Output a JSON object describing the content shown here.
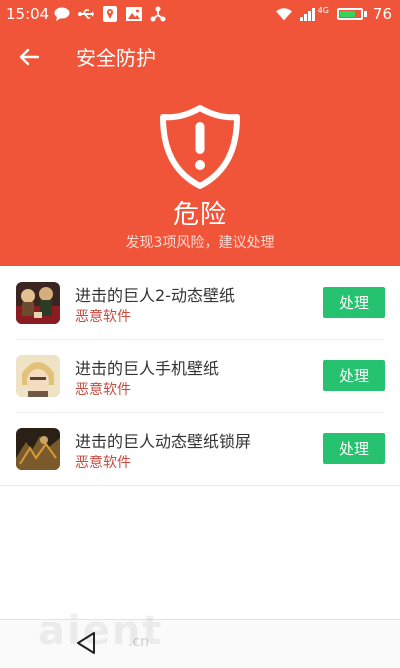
{
  "status_bar": {
    "time": "15:04",
    "network_label": "4G",
    "battery_level": "76",
    "battery_fraction": 0.76,
    "icons": [
      "chat-icon",
      "usb-icon",
      "location-icon",
      "image-icon",
      "share-icon",
      "wifi-icon",
      "signal-icon",
      "battery-icon"
    ]
  },
  "appbar": {
    "title": "安全防护",
    "back_icon": "arrow-left-icon"
  },
  "summary": {
    "status": "危险",
    "subtitle": "发现3项风险，建议处理",
    "icon": "shield-alert-icon"
  },
  "risks": [
    {
      "name": "进击的巨人2-动态壁纸",
      "type": "恶意软件",
      "action": "处理"
    },
    {
      "name": "进击的巨人手机壁纸",
      "type": "恶意软件",
      "action": "处理"
    },
    {
      "name": "进击的巨人动态壁纸锁屏",
      "type": "恶意软件",
      "action": "处理"
    }
  ],
  "navbar": {
    "back_icon": "triangle-back-icon"
  },
  "watermark": {
    "text": "aient",
    "suffix": ".cn"
  },
  "colors": {
    "header": "#f0553a",
    "action_button": "#27c26f",
    "risk_type": "#c64b3f"
  }
}
